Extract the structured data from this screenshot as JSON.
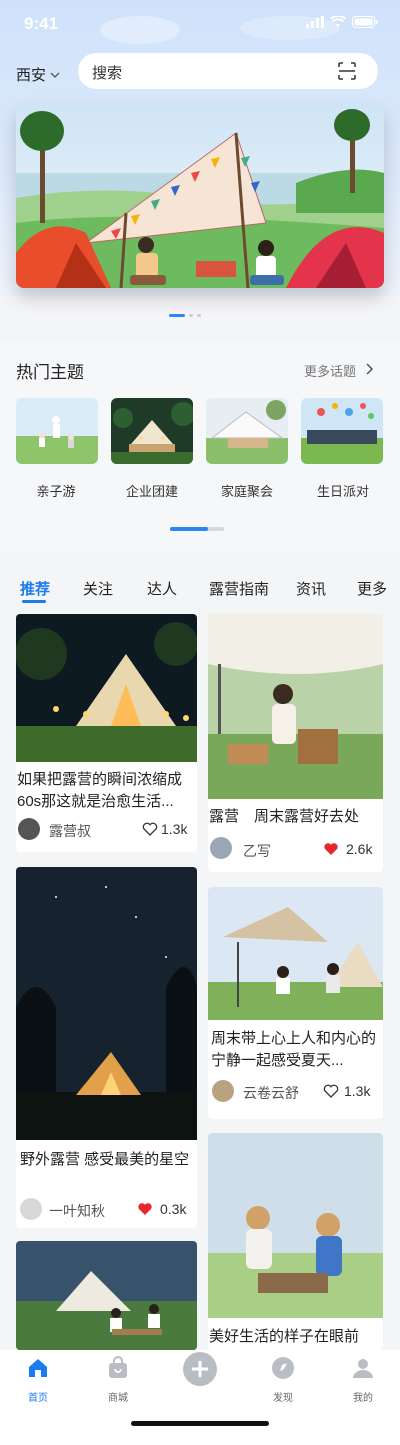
{
  "status": {
    "time": "9:41"
  },
  "header": {
    "city": "西安",
    "search_placeholder": "搜索"
  },
  "banner": {
    "slide_count": 3,
    "active_slide": 1
  },
  "topics": {
    "title": "热门主题",
    "more_label": "更多话题",
    "items": [
      {
        "label": "亲子游"
      },
      {
        "label": "企业团建"
      },
      {
        "label": "家庭聚会"
      },
      {
        "label": "生日派对"
      }
    ]
  },
  "tabs": [
    "推荐",
    "关注",
    "达人",
    "露营指南",
    "资讯",
    "更多"
  ],
  "active_tab": 0,
  "feed": [
    {
      "title": "如果把露营的瞬间浓缩成60s那这就是治愈生活...",
      "author": "露营叔",
      "likes": "1.3k",
      "liked": false
    },
    {
      "title": "露营　周末露营好去处",
      "author": "乙写",
      "likes": "2.6k",
      "liked": true
    },
    {
      "title": "周末带上心上人和内心的宁静一起感受夏天...",
      "author": "云卷云舒",
      "likes": "1.3k",
      "liked": false
    },
    {
      "title": "野外露营 感受最美的星空",
      "author": "一叶知秋",
      "likes": "0.3k",
      "liked": true
    },
    {
      "title": "美好生活的样子在眼前",
      "author": "",
      "likes": "",
      "liked": false
    }
  ],
  "nav": [
    "首页",
    "商城",
    "",
    "发现",
    "我的"
  ],
  "colors": {
    "accent": "#1a7cf0",
    "like_red": "#e8282f"
  }
}
